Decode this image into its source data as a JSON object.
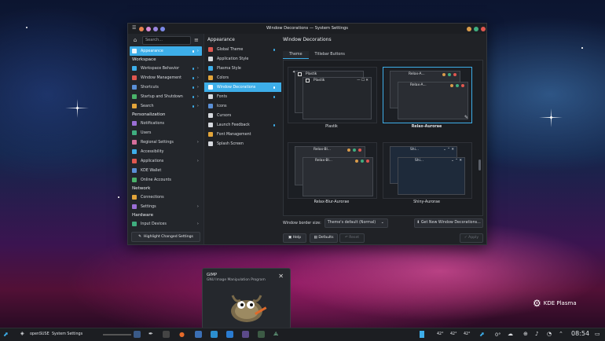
{
  "window": {
    "title": "Window Decorations — System Settings"
  },
  "sidebar": {
    "search_placeholder": "Search...",
    "selected": "Appearance",
    "groups": [
      {
        "heading": "Workspace",
        "items": [
          {
            "label": "Workspace Behavior",
            "dot": true,
            "chevron": true
          },
          {
            "label": "Window Management",
            "dot": true,
            "chevron": true
          },
          {
            "label": "Shortcuts",
            "dot": true,
            "chevron": true
          },
          {
            "label": "Startup and Shutdown",
            "dot": true,
            "chevron": true
          },
          {
            "label": "Search",
            "dot": true,
            "chevron": true
          }
        ]
      },
      {
        "heading": "Personalization",
        "items": [
          {
            "label": "Notifications",
            "dot": false,
            "chevron": false
          },
          {
            "label": "Users",
            "dot": false,
            "chevron": false
          },
          {
            "label": "Regional Settings",
            "dot": false,
            "chevron": true
          },
          {
            "label": "Accessibility",
            "dot": false,
            "chevron": false
          },
          {
            "label": "Applications",
            "dot": false,
            "chevron": true
          },
          {
            "label": "KDE Wallet",
            "dot": false,
            "chevron": false
          },
          {
            "label": "Online Accounts",
            "dot": false,
            "chevron": false
          }
        ]
      },
      {
        "heading": "Network",
        "items": [
          {
            "label": "Connections",
            "dot": false,
            "chevron": false
          },
          {
            "label": "Settings",
            "dot": false,
            "chevron": true
          }
        ]
      },
      {
        "heading": "Hardware",
        "items": [
          {
            "label": "Input Devices",
            "dot": false,
            "chevron": true
          }
        ]
      }
    ],
    "footer_button": "Highlight Changed Settings"
  },
  "middle": {
    "title": "Appearance",
    "items": [
      {
        "label": "Global Theme",
        "dot": true
      },
      {
        "label": "Application Style",
        "dot": false
      },
      {
        "label": "Plasma Style",
        "dot": false
      },
      {
        "label": "Colors",
        "dot": false
      },
      {
        "label": "Window Decorations",
        "dot": true,
        "active": true
      },
      {
        "label": "Fonts",
        "dot": true
      },
      {
        "label": "Icons",
        "dot": false
      },
      {
        "label": "Cursors",
        "dot": false
      },
      {
        "label": "Launch Feedback",
        "dot": true
      },
      {
        "label": "Font Management",
        "dot": false
      },
      {
        "label": "Splash Screen",
        "dot": false
      }
    ]
  },
  "content": {
    "title": "Window Decorations",
    "tabs": [
      "Theme",
      "Titlebar Buttons"
    ],
    "themes": [
      {
        "name": "Plastik",
        "preview_label": "Plastik",
        "selected": false
      },
      {
        "name": "Relax-Aurorae",
        "preview_label": "Relax-A...",
        "selected": true
      },
      {
        "name": "Relax-Blur-Aurorae",
        "preview_label": "Relax-Bl...",
        "selected": false
      },
      {
        "name": "Shiny-Aurorae",
        "preview_label": "Shi...",
        "selected": false
      }
    ],
    "border_size_label": "Window border size:",
    "border_size_value": "Theme's default (Normal)",
    "get_new_button": "Get New Window Decorations...",
    "help_button": "Help",
    "defaults_button": "Defaults",
    "reset_button": "Reset",
    "apply_button": "Apply"
  },
  "notification": {
    "title": "GIMP",
    "subtitle": "GNU Image Manipulation Program"
  },
  "branding": {
    "text": "KDE Plasma"
  },
  "taskbar": {
    "distro_label": "openSUSE",
    "active_window": "System Settings",
    "temps": [
      "42°",
      "42°",
      "42°"
    ],
    "weather_temp": "0°",
    "clock": "08:54"
  },
  "colors": {
    "accent": "#3daee9",
    "close": "#e0574f",
    "max": "#3fae7f",
    "min": "#d99b4a"
  }
}
